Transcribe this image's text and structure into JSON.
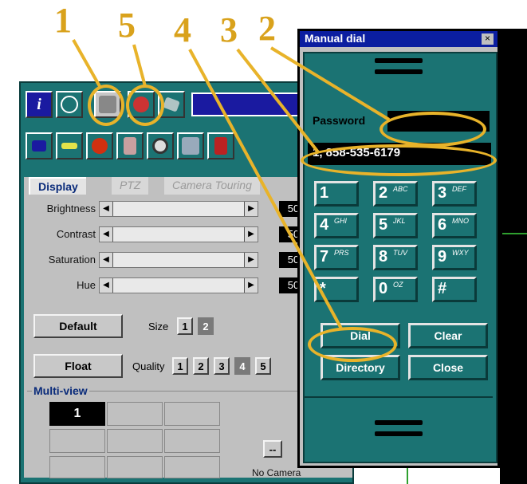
{
  "callouts": [
    "1",
    "5",
    "4",
    "3",
    "2"
  ],
  "main": {
    "tabs": [
      "Display",
      "PTZ",
      "Camera Touring"
    ],
    "sliders": [
      {
        "label": "Brightness",
        "value": "50"
      },
      {
        "label": "Contrast",
        "value": "50"
      },
      {
        "label": "Saturation",
        "value": "50"
      },
      {
        "label": "Hue",
        "value": "50"
      }
    ],
    "default_label": "Default",
    "float_label": "Float",
    "size_label": "Size",
    "size_options": [
      "1",
      "2"
    ],
    "quality_label": "Quality",
    "quality_options": [
      "1",
      "2",
      "3",
      "4",
      "5"
    ],
    "multiview_label": "Multi-view",
    "grid_first_cell": "1",
    "camera_button": "--",
    "no_camera": "No Camera"
  },
  "dialog": {
    "title": "Manual dial",
    "close_glyph": "×",
    "password_label": "Password",
    "password_value": "",
    "number_value": "1, 858-535-6179",
    "keys": [
      {
        "main": "1",
        "sub": ""
      },
      {
        "main": "2",
        "sub": "ABC"
      },
      {
        "main": "3",
        "sub": "DEF"
      },
      {
        "main": "4",
        "sub": "GHI"
      },
      {
        "main": "5",
        "sub": "JKL"
      },
      {
        "main": "6",
        "sub": "MNO"
      },
      {
        "main": "7",
        "sub": "PRS"
      },
      {
        "main": "8",
        "sub": "TUV"
      },
      {
        "main": "9",
        "sub": "WXY"
      },
      {
        "main": "*",
        "sub": ""
      },
      {
        "main": "0",
        "sub": "OZ"
      },
      {
        "main": "#",
        "sub": ""
      }
    ],
    "dial_label": "Dial",
    "clear_label": "Clear",
    "directory_label": "Directory",
    "close_label": "Close"
  },
  "colors": {
    "teal": "#1b7373",
    "callout": "#d9a21c",
    "title_bar": "#0b1ea0"
  }
}
